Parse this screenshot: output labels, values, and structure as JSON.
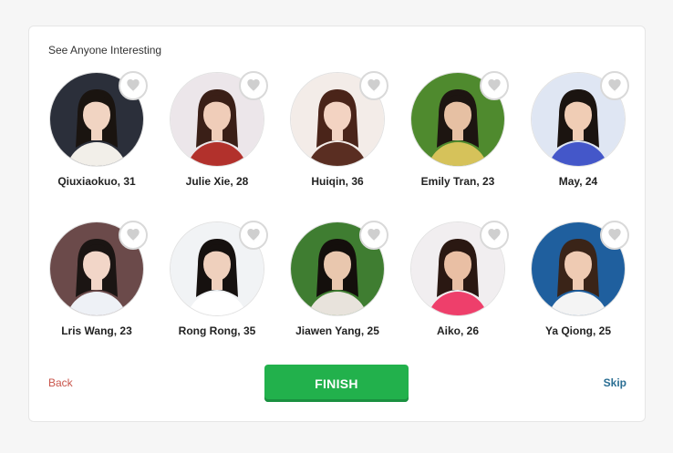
{
  "section": {
    "heading": "See Anyone Interesting"
  },
  "profiles": [
    {
      "name": "Qiuxiaokuo, 31",
      "photo_bg": "#2b2f3a",
      "photo_accent": "#f2efe9",
      "hair": "#1a1410",
      "skin": "#f1d4c2",
      "like_icon": "heart-icon"
    },
    {
      "name": "Julie Xie, 28",
      "photo_bg": "#ece6ea",
      "photo_accent": "#b2312c",
      "hair": "#3a1f17",
      "skin": "#f0cdb9",
      "like_icon": "heart-icon"
    },
    {
      "name": "Huiqin, 36",
      "photo_bg": "#f3ece8",
      "photo_accent": "#5a2e22",
      "hair": "#4a2419",
      "skin": "#f3d3c2",
      "like_icon": "heart-icon"
    },
    {
      "name": "Emily Tran, 23",
      "photo_bg": "#4f8a2e",
      "photo_accent": "#d6c25a",
      "hair": "#1d1511",
      "skin": "#e6c0a3",
      "like_icon": "heart-icon"
    },
    {
      "name": "May, 24",
      "photo_bg": "#dfe6f3",
      "photo_accent": "#4457c9",
      "hair": "#1b1410",
      "skin": "#f0cdb5",
      "like_icon": "heart-icon"
    },
    {
      "name": "Lris Wang, 23",
      "photo_bg": "#6b4a4a",
      "photo_accent": "#eef1f6",
      "hair": "#1b1513",
      "skin": "#f2d6c8",
      "like_icon": "heart-icon"
    },
    {
      "name": "Rong Rong, 35",
      "photo_bg": "#f1f3f5",
      "photo_accent": "#ffffff",
      "hair": "#16110f",
      "skin": "#efd0bd",
      "like_icon": "heart-icon"
    },
    {
      "name": "Jiawen Yang, 25",
      "photo_bg": "#3f7d31",
      "photo_accent": "#e8e3dc",
      "hair": "#140f0c",
      "skin": "#e9c7ae",
      "like_icon": "heart-icon"
    },
    {
      "name": "Aiko, 26",
      "photo_bg": "#f1eef0",
      "photo_accent": "#ee3f6b",
      "hair": "#2a1812",
      "skin": "#e9bfa4",
      "like_icon": "heart-icon"
    },
    {
      "name": "Ya Qiong, 25",
      "photo_bg": "#1f5f9e",
      "photo_accent": "#f4f4f4",
      "hair": "#3a2418",
      "skin": "#efcbb3",
      "like_icon": "heart-icon"
    }
  ],
  "actions": {
    "back_label": "Back",
    "finish_label": "FINISH",
    "skip_label": "Skip"
  },
  "colors": {
    "finish": "#22b14c",
    "back": "#c9554b",
    "skip": "#2a6e93",
    "heart": "#cfcfcf"
  }
}
